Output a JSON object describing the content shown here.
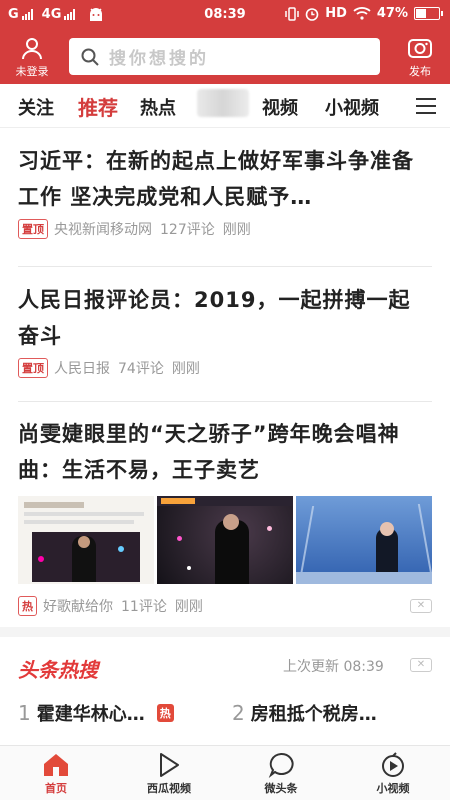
{
  "status_bar": {
    "carrier1": "G",
    "carrier2": "4G",
    "time": "08:39",
    "hd": "HD",
    "battery": "47%",
    "battery_level": 0.47
  },
  "header": {
    "login_label": "未登录",
    "search_placeholder": "搜你想搜的",
    "publish_label": "发布"
  },
  "tabs": [
    {
      "label": "关注",
      "active": false
    },
    {
      "label": "推荐",
      "active": true
    },
    {
      "label": "热点",
      "active": false
    },
    {
      "label": "视频",
      "active": false
    },
    {
      "label": "小视频",
      "active": false
    }
  ],
  "articles": [
    {
      "title": "习近平：在新的起点上做好军事斗争准备工作 坚决完成党和人民赋予…",
      "tag": "置顶",
      "source": "央视新闻移动网",
      "comments": "127评论",
      "time": "刚刚"
    },
    {
      "title": "人民日报评论员：2019，一起拼搏一起奋斗",
      "tag": "置顶",
      "source": "人民日报",
      "comments": "74评论",
      "time": "刚刚"
    },
    {
      "title": "尚雯婕眼里的“天之骄子”跨年晚会唱神曲：生活不易，王子卖艺",
      "tag": "热",
      "source": "好歌献给你",
      "comments": "11评论",
      "time": "刚刚"
    }
  ],
  "hot_search": {
    "title": "头条热搜",
    "update_label": "上次更新",
    "update_time": "08:39",
    "items": [
      {
        "num": "1",
        "text": "霍建华林心…",
        "badge": "热"
      },
      {
        "num": "2",
        "text": "房租抵个税房…"
      }
    ]
  },
  "bottom_nav": [
    {
      "label": "首页",
      "icon": "home-icon",
      "active": true
    },
    {
      "label": "西瓜视频",
      "icon": "play-icon",
      "active": false
    },
    {
      "label": "微头条",
      "icon": "chat-bubble-icon",
      "active": false
    },
    {
      "label": "小视频",
      "icon": "short-video-icon",
      "active": false
    }
  ],
  "colors": {
    "brand_red": "#d43d3d"
  }
}
